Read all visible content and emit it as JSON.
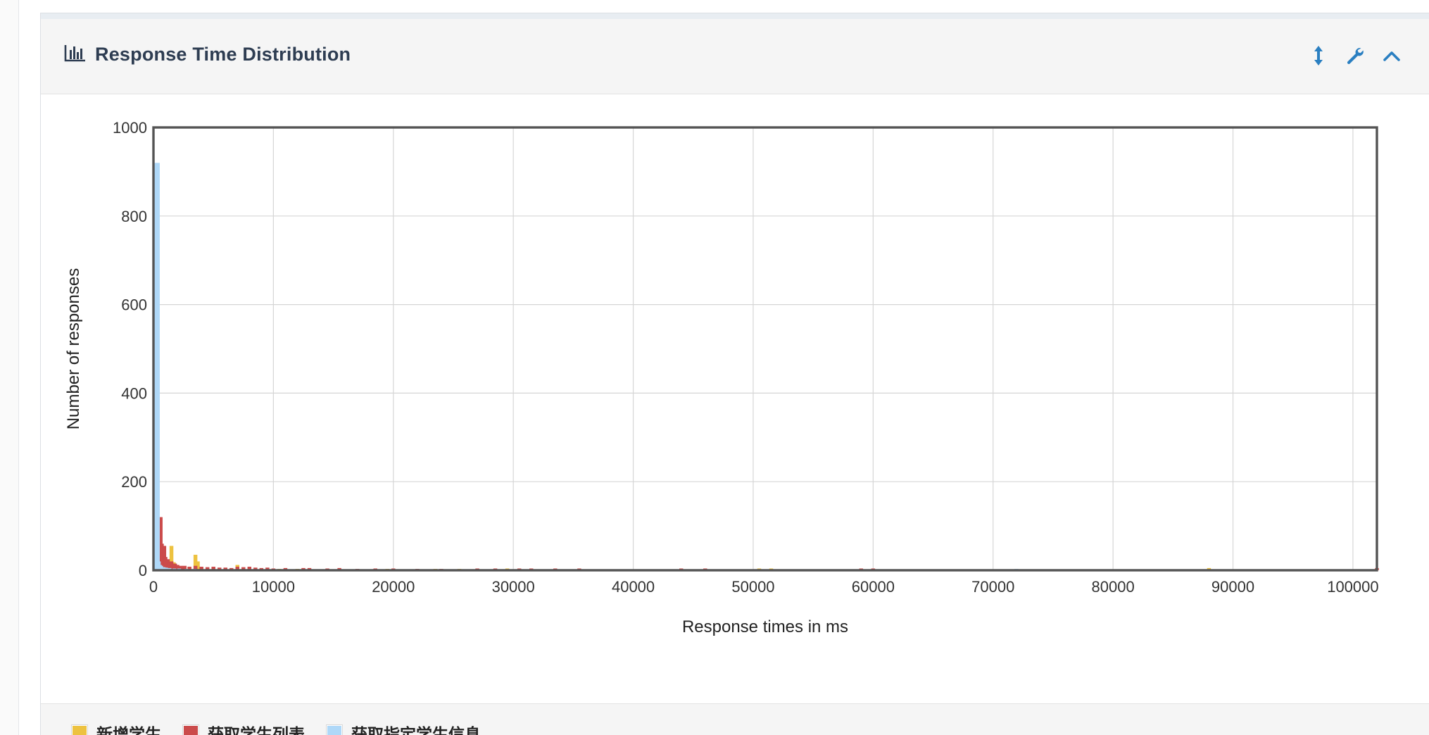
{
  "panel": {
    "title": "Response Time Distribution",
    "icons": [
      "bar-chart-icon",
      "resize-vertical-icon",
      "wrench-icon",
      "chevron-up-icon"
    ]
  },
  "colors": {
    "series1": "#edc240",
    "series2": "#cb4b4b",
    "series3": "#afd8f8",
    "grid": "#d6d6d6",
    "frame": "#545454",
    "icon_blue": "#2a7fc1",
    "title": "#2e3d52"
  },
  "chart_data": {
    "type": "bar",
    "title": "Response Time Distribution",
    "xlabel": "Response times in ms",
    "ylabel": "Number of responses",
    "xlim": [
      0,
      102000
    ],
    "ylim": [
      0,
      1000
    ],
    "x_ticks": [
      0,
      10000,
      20000,
      30000,
      40000,
      50000,
      60000,
      70000,
      80000,
      90000,
      100000
    ],
    "y_ticks": [
      0,
      200,
      400,
      600,
      800,
      1000
    ],
    "grid": true,
    "legend_position": "bottom",
    "bin_width_ms": 100,
    "series": [
      {
        "name": "新增学生",
        "color": "#edc240",
        "points": [
          [
            0,
            220
          ],
          [
            100,
            200
          ],
          [
            200,
            60
          ],
          [
            300,
            30
          ],
          [
            400,
            20
          ],
          [
            500,
            15
          ],
          [
            700,
            12
          ],
          [
            900,
            10
          ],
          [
            1200,
            12
          ],
          [
            1500,
            55
          ],
          [
            1700,
            18
          ],
          [
            2000,
            8
          ],
          [
            2500,
            6
          ],
          [
            3000,
            8
          ],
          [
            3500,
            35
          ],
          [
            3700,
            20
          ],
          [
            4000,
            6
          ],
          [
            5000,
            5
          ],
          [
            6000,
            4
          ],
          [
            7000,
            12
          ],
          [
            8000,
            4
          ],
          [
            9000,
            3
          ],
          [
            10500,
            3
          ],
          [
            12000,
            3
          ],
          [
            14000,
            2
          ],
          [
            16000,
            2
          ],
          [
            19500,
            3
          ],
          [
            21000,
            2
          ],
          [
            23500,
            3
          ],
          [
            25500,
            3
          ],
          [
            29500,
            4
          ],
          [
            32000,
            2
          ],
          [
            50500,
            4
          ],
          [
            51500,
            4
          ],
          [
            88000,
            5
          ]
        ]
      },
      {
        "name": "获取学生列表",
        "color": "#cb4b4b",
        "points": [
          [
            0,
            40
          ],
          [
            100,
            25
          ],
          [
            200,
            15
          ],
          [
            300,
            20
          ],
          [
            400,
            30
          ],
          [
            500,
            90
          ],
          [
            600,
            120
          ],
          [
            700,
            60
          ],
          [
            800,
            40
          ],
          [
            900,
            55
          ],
          [
            1000,
            30
          ],
          [
            1100,
            20
          ],
          [
            1200,
            25
          ],
          [
            1300,
            18
          ],
          [
            1500,
            20
          ],
          [
            1800,
            15
          ],
          [
            2000,
            12
          ],
          [
            2300,
            10
          ],
          [
            2600,
            10
          ],
          [
            3000,
            8
          ],
          [
            3500,
            10
          ],
          [
            4000,
            8
          ],
          [
            4500,
            7
          ],
          [
            5000,
            8
          ],
          [
            5500,
            6
          ],
          [
            6000,
            6
          ],
          [
            6500,
            5
          ],
          [
            7000,
            8
          ],
          [
            7500,
            7
          ],
          [
            8000,
            8
          ],
          [
            8500,
            6
          ],
          [
            9000,
            5
          ],
          [
            9500,
            6
          ],
          [
            10000,
            4
          ],
          [
            11000,
            5
          ],
          [
            12500,
            5
          ],
          [
            13000,
            5
          ],
          [
            14500,
            4
          ],
          [
            15500,
            5
          ],
          [
            17000,
            3
          ],
          [
            18500,
            4
          ],
          [
            20000,
            4
          ],
          [
            22000,
            3
          ],
          [
            24000,
            3
          ],
          [
            27000,
            4
          ],
          [
            28500,
            4
          ],
          [
            30500,
            4
          ],
          [
            31500,
            4
          ],
          [
            33500,
            4
          ],
          [
            35500,
            4
          ],
          [
            44000,
            4
          ],
          [
            46000,
            4
          ],
          [
            59000,
            4
          ],
          [
            60000,
            4
          ],
          [
            102000,
            5
          ]
        ]
      },
      {
        "name": "获取指定学生信息",
        "color": "#afd8f8",
        "points": [
          [
            0,
            920
          ],
          [
            100,
            470
          ],
          [
            200,
            120
          ],
          [
            300,
            60
          ],
          [
            400,
            35
          ],
          [
            500,
            20
          ],
          [
            600,
            12
          ],
          [
            700,
            10
          ],
          [
            900,
            7
          ],
          [
            1100,
            6
          ],
          [
            1400,
            5
          ],
          [
            1800,
            4
          ],
          [
            2200,
            4
          ],
          [
            2800,
            3
          ],
          [
            3500,
            3
          ],
          [
            4300,
            2
          ],
          [
            5200,
            2
          ],
          [
            6200,
            2
          ],
          [
            7200,
            2
          ],
          [
            8200,
            2
          ],
          [
            9500,
            2
          ],
          [
            11000,
            2
          ],
          [
            12800,
            2
          ],
          [
            14800,
            2
          ],
          [
            22000,
            2
          ],
          [
            72000,
            3
          ]
        ]
      }
    ]
  }
}
